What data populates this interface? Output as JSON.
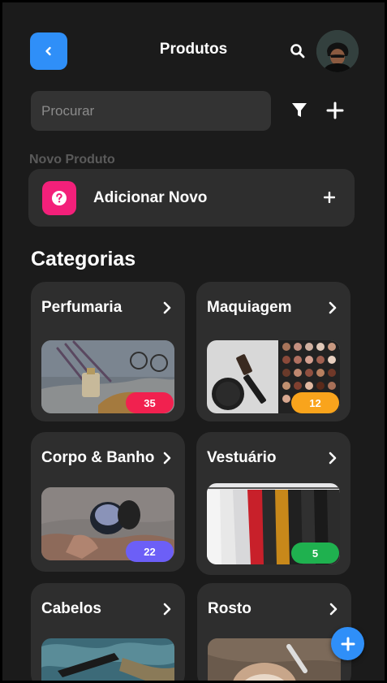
{
  "header": {
    "title": "Produtos",
    "back_icon": "chevron-left-icon",
    "search_icon": "search-icon",
    "avatar_icon": "user-avatar"
  },
  "search": {
    "placeholder": "Procurar",
    "value": "",
    "filter_icon": "filter-icon",
    "add_icon": "plus-icon"
  },
  "new_product": {
    "section_label": "Novo Produto",
    "label": "Adicionar Novo",
    "icon": "question-circle-icon",
    "icon_color": "#f3207a",
    "plus_icon": "plus-icon"
  },
  "categories_title": "Categorias",
  "categories": [
    {
      "name": "Perfumaria",
      "count": "35",
      "badge_color": "#f1214f"
    },
    {
      "name": "Maquiagem",
      "count": "12",
      "badge_color": "#f9a41c"
    },
    {
      "name": "Corpo & Banho",
      "count": "22",
      "badge_color": "#6c5ff7"
    },
    {
      "name": "Vestuário",
      "count": "5",
      "badge_color": "#1fb14f"
    },
    {
      "name": "Cabelos",
      "count": "",
      "badge_color": ""
    },
    {
      "name": "Rosto",
      "count": "",
      "badge_color": ""
    }
  ],
  "colors": {
    "accent": "#2f8ff8",
    "background": "#1b1b1b",
    "card": "#2e2e2e"
  },
  "fab": {
    "icon": "plus-icon"
  }
}
